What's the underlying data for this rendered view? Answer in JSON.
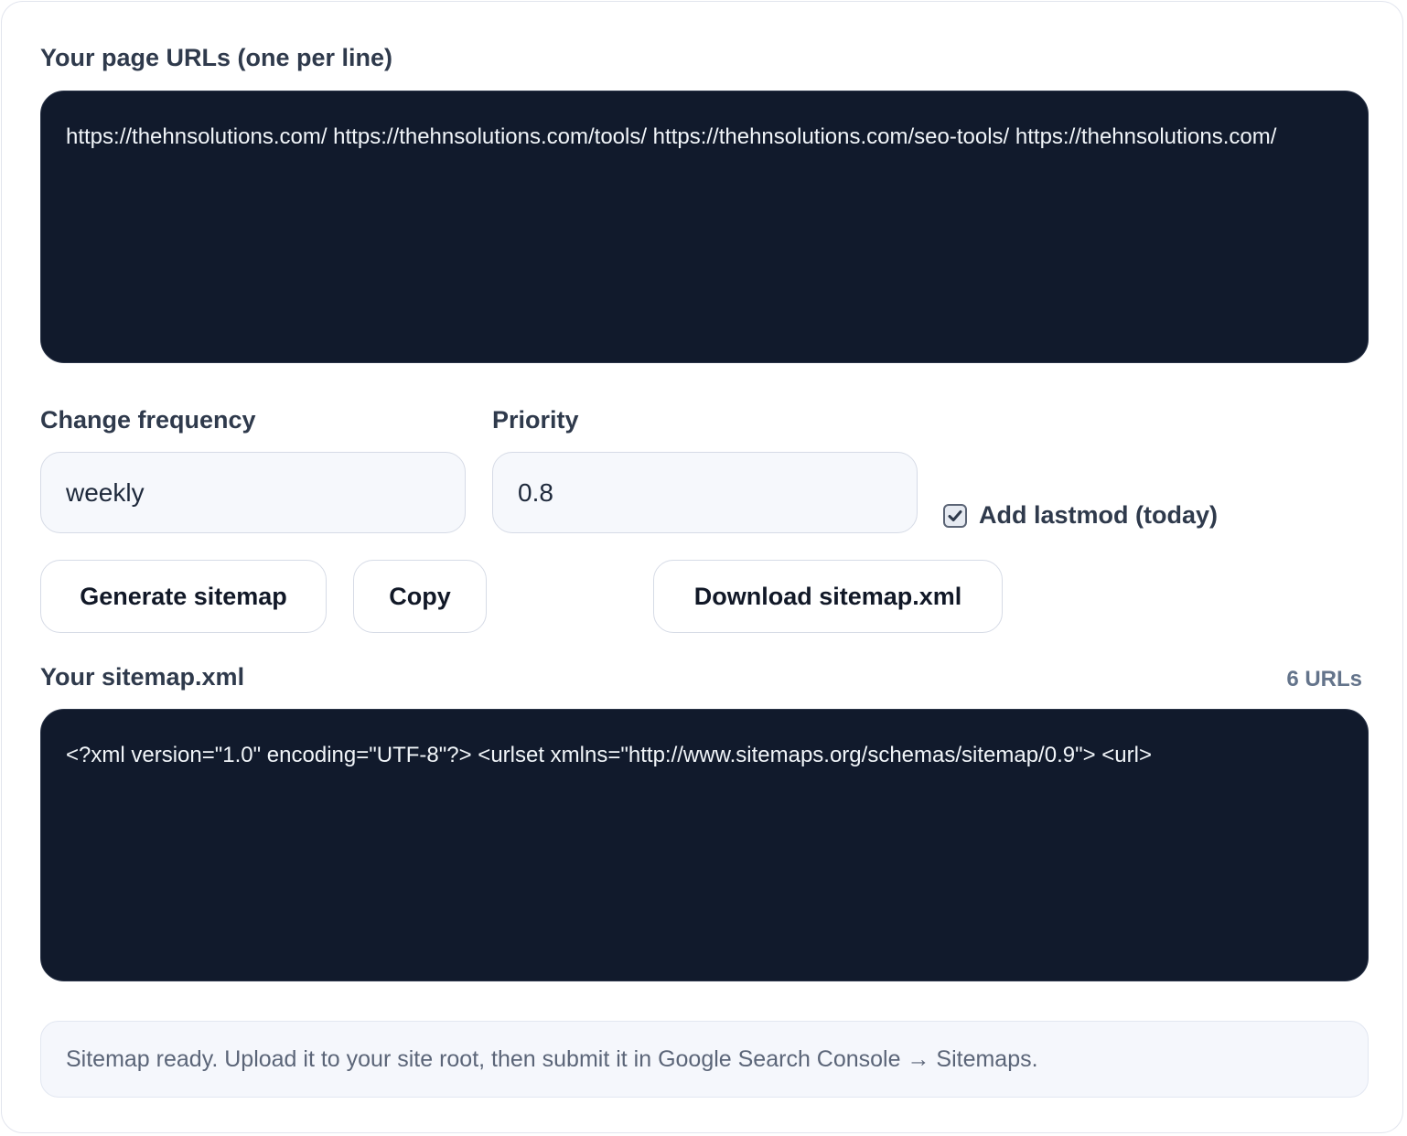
{
  "urls_section": {
    "label": "Your page URLs (one per line)",
    "value": "https://thehnsolutions.com/ https://thehnsolutions.com/tools/ https://thehnsolutions.com/seo-tools/ https://thehnsolutions.com/"
  },
  "frequency": {
    "label": "Change frequency",
    "value": "weekly"
  },
  "priority": {
    "label": "Priority",
    "value": "0.8"
  },
  "lastmod": {
    "label": "Add lastmod (today)",
    "checked": true
  },
  "buttons": {
    "generate": "Generate sitemap",
    "copy": "Copy",
    "download": "Download sitemap.xml"
  },
  "output": {
    "label": "Your sitemap.xml",
    "count": "6 URLs",
    "value": "<?xml version=\"1.0\" encoding=\"UTF-8\"?> <urlset xmlns=\"http://www.sitemaps.org/schemas/sitemap/0.9\">   <url>"
  },
  "status": {
    "message": "Sitemap ready. Upload it to your site root, then submit it in Google Search Console → Sitemaps."
  },
  "icons": {
    "checkbox": "check-icon"
  },
  "colors": {
    "dark_panel": "#111a2c",
    "field_bg": "#f6f8fc",
    "label": "#2f3a4c"
  }
}
